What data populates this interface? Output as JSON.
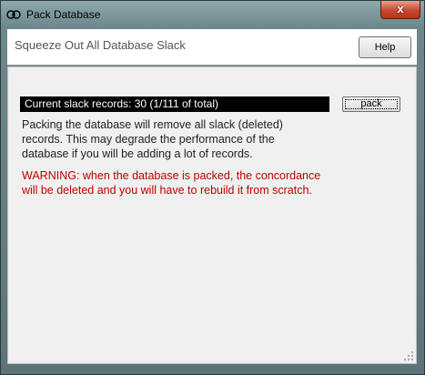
{
  "window": {
    "title": "Pack Database",
    "icon": "pack-database-app-icon",
    "close_label": "x"
  },
  "header": {
    "title": "Squeeze Out All Database Slack",
    "help_label": "Help"
  },
  "main": {
    "slack_status": "Current slack records: 30 (1/111 of total)",
    "pack_label": "pack",
    "info": "Packing the database will remove all slack (deleted) records. This may degrade the performance of the database if you will be adding a lot of records.",
    "warning": "WARNING: when the database is packed, the concordance will be deleted and you will have to rebuild it from scratch."
  },
  "colors": {
    "warning": "#c00000",
    "status_bar_bg": "#000000",
    "status_bar_fg": "#ffffff"
  }
}
